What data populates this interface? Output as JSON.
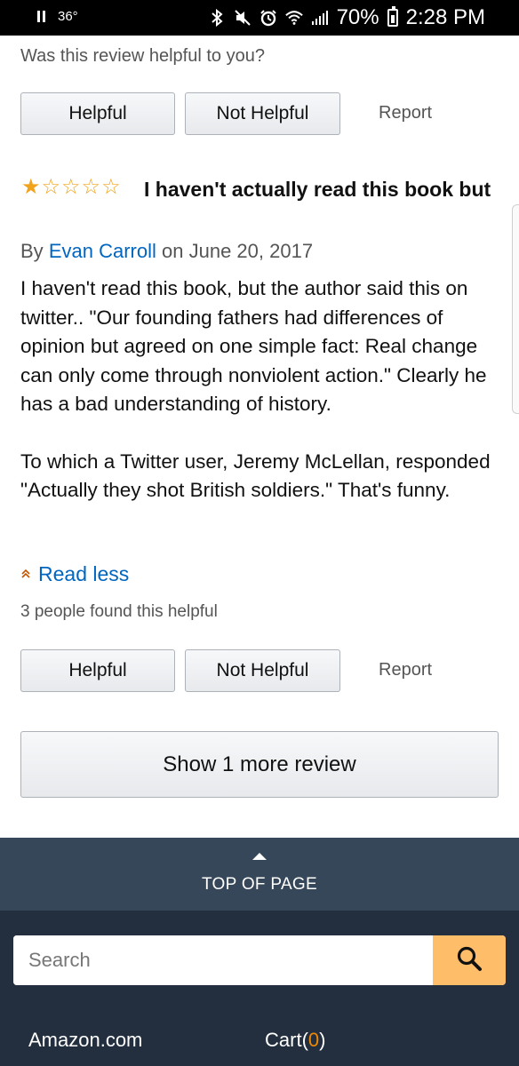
{
  "status_bar": {
    "temperature": "36°",
    "battery": "70%",
    "time": "2:28 PM",
    "icons": [
      "pause-icon",
      "bluetooth-icon",
      "mute-icon",
      "alarm-icon",
      "wifi-icon",
      "signal-icon",
      "battery-icon"
    ]
  },
  "previous_review": {
    "question": "Was this review helpful to you?",
    "helpful_label": "Helpful",
    "not_helpful_label": "Not Helpful",
    "report_label": "Report"
  },
  "review": {
    "rating": 1,
    "rating_max": 5,
    "title": "I haven't actually read this book but",
    "by_prefix": "By",
    "author": "Evan Carroll",
    "date_prefix": "on",
    "date": "June 20, 2017",
    "body_paragraph_1": "I haven't read this book, but the author said this on twitter.. \"Our founding fathers had differences of opinion but agreed on one simple fact: Real change can only come through nonviolent action.\" Clearly he has a bad understanding of history.",
    "body_paragraph_2": "To which a Twitter user, Jeremy McLellan, responded \"Actually they shot British soldiers.\" That's funny.",
    "read_less_label": "Read less",
    "helpful_count_text": "3 people found this helpful",
    "helpful_label": "Helpful",
    "not_helpful_label": "Not Helpful",
    "report_label": "Report"
  },
  "show_more_label": "Show 1 more review",
  "top_of_page_label": "TOP OF PAGE",
  "footer": {
    "search_placeholder": "Search",
    "amazon_link": "Amazon.com",
    "cart_label": "Cart",
    "cart_count": "0"
  },
  "colors": {
    "link": "#0066c0",
    "star": "#f0a31b",
    "top_of_page_bg": "#37475a",
    "footer_bg": "#232f3e",
    "search_button": "#febd69",
    "cart_count": "#f08804"
  }
}
